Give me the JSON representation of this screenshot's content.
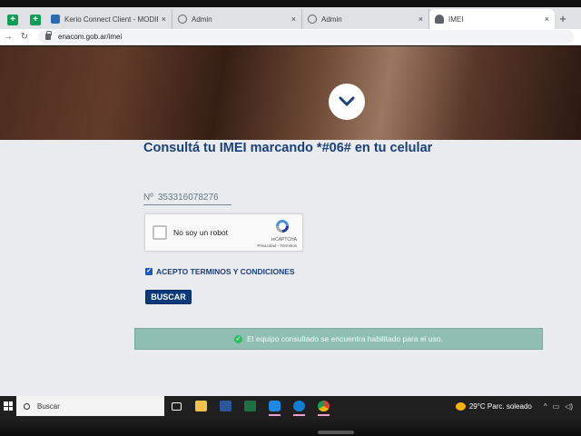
{
  "browser": {
    "tabs": [
      {
        "label": "Kerio Connect Client - MODIFICA",
        "icon": "kerio-icon"
      },
      {
        "label": "Admin",
        "icon": "globe-icon"
      },
      {
        "label": "Admin",
        "icon": "globe-icon"
      },
      {
        "label": "IMEI",
        "icon": "bell-icon"
      }
    ],
    "close_glyph": "×",
    "new_tab_glyph": "+",
    "url": "enacom.gob.ar/imei"
  },
  "page": {
    "title": "Consultá tu IMEI marcando *#06# en tu celular",
    "imei_prefix": "Nº",
    "imei_value": "353316078276",
    "recaptcha": {
      "label": "No soy un robot",
      "brand": "reCAPTCHA",
      "links": "Privacidad - Términos",
      "checked": false
    },
    "terms": {
      "label": "ACEPTO TERMINOS Y CONDICIONES",
      "checked": true
    },
    "search_button": "BUSCAR",
    "result_message": "El equipo consultado se encuentra habilitado para el uso."
  },
  "taskbar": {
    "search_placeholder": "Buscar",
    "weather": "29°C  Parc. soleado",
    "apps": [
      "task-view",
      "file-explorer",
      "word",
      "excel",
      "app-blue",
      "app-ring",
      "chrome"
    ]
  },
  "colors": {
    "title": "#1b3f7a",
    "button": "#0b3a7a",
    "success_bar": "#8fbfb3",
    "taskbar": "#202020"
  }
}
